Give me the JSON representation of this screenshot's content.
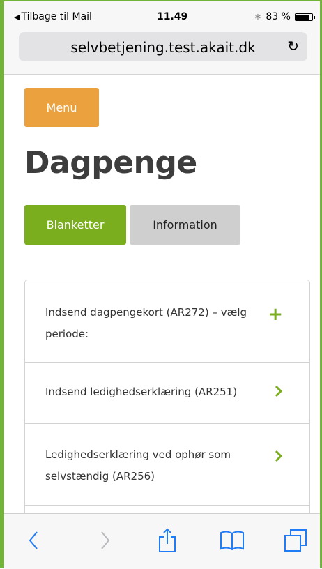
{
  "status_bar": {
    "back_label": "Tilbage til Mail",
    "time": "11.49",
    "battery_percent": "83 %",
    "battery_level": 0.83
  },
  "browser": {
    "url": "selvbetjening.test.akait.dk"
  },
  "page": {
    "menu_label": "Menu",
    "title": "Dagpenge",
    "tabs": [
      {
        "label": "Blanketter",
        "active": true
      },
      {
        "label": "Information",
        "active": false
      }
    ],
    "items": [
      {
        "label": "Indsend dagpengekort (AR272) – vælg periode:",
        "icon": "plus-icon"
      },
      {
        "label": "Indsend ledighedserklæring (AR251)",
        "icon": "chevron-right-icon"
      },
      {
        "label": "Ledighedserklæring ved ophør som selvstændig (AR256)",
        "icon": "chevron-right-icon"
      }
    ]
  },
  "colors": {
    "accent_green": "#7bae1e",
    "menu_orange": "#eba23e",
    "ios_blue": "#1f7bf6"
  }
}
